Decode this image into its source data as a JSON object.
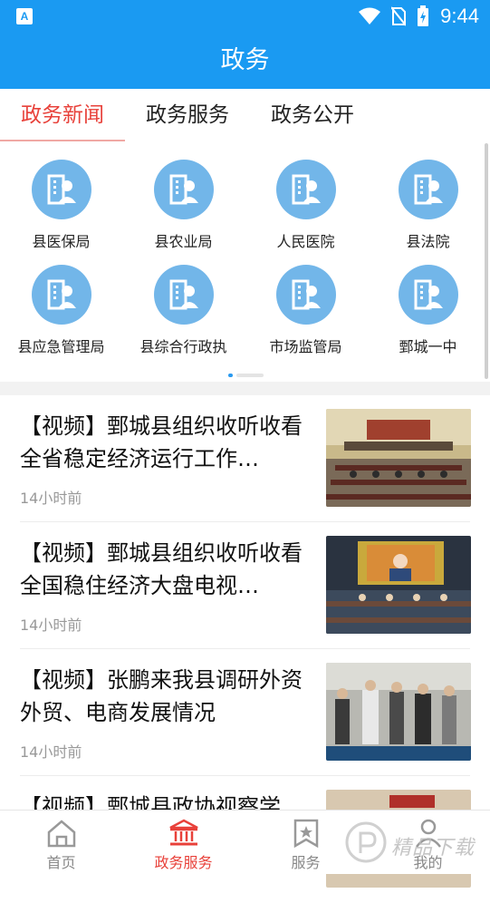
{
  "status_bar": {
    "time": "9:44",
    "app_icon_letter": "A"
  },
  "header": {
    "title": "政务"
  },
  "tabs": [
    {
      "label": "政务新闻",
      "active": true
    },
    {
      "label": "政务服务",
      "active": false
    },
    {
      "label": "政务公开",
      "active": false
    }
  ],
  "departments": [
    {
      "label": "县医保局",
      "icon": "department-icon"
    },
    {
      "label": "县农业局",
      "icon": "department-icon"
    },
    {
      "label": "人民医院",
      "icon": "department-icon"
    },
    {
      "label": "县法院",
      "icon": "department-icon"
    },
    {
      "label": "县应急管理局",
      "icon": "department-icon"
    },
    {
      "label": "县综合行政执",
      "icon": "department-icon"
    },
    {
      "label": "市场监管局",
      "icon": "department-icon"
    },
    {
      "label": "鄄城一中",
      "icon": "department-icon"
    }
  ],
  "news": [
    {
      "title": "【视频】鄄城县组织收听收看全省稳定经济运行工作…",
      "time": "14小时前"
    },
    {
      "title": "【视频】鄄城县组织收听收看全国稳住经济大盘电视…",
      "time": "14小时前"
    },
    {
      "title": "【视频】张鹏来我县调研外资外贸、电商发展情况",
      "time": "14小时前"
    },
    {
      "title": "【视频】鄄城县政协视察学",
      "time": ""
    }
  ],
  "bottom_nav": [
    {
      "label": "首页",
      "icon": "home-icon",
      "active": false
    },
    {
      "label": "政务服务",
      "icon": "government-building-icon",
      "active": true
    },
    {
      "label": "服务",
      "icon": "star-bookmark-icon",
      "active": false
    },
    {
      "label": "我的",
      "icon": "person-icon",
      "active": false
    }
  ],
  "watermark": {
    "text": "精品下载"
  },
  "colors": {
    "primary": "#1a9af2",
    "accent": "#e8413a",
    "icon_bg": "#72b6e9"
  }
}
